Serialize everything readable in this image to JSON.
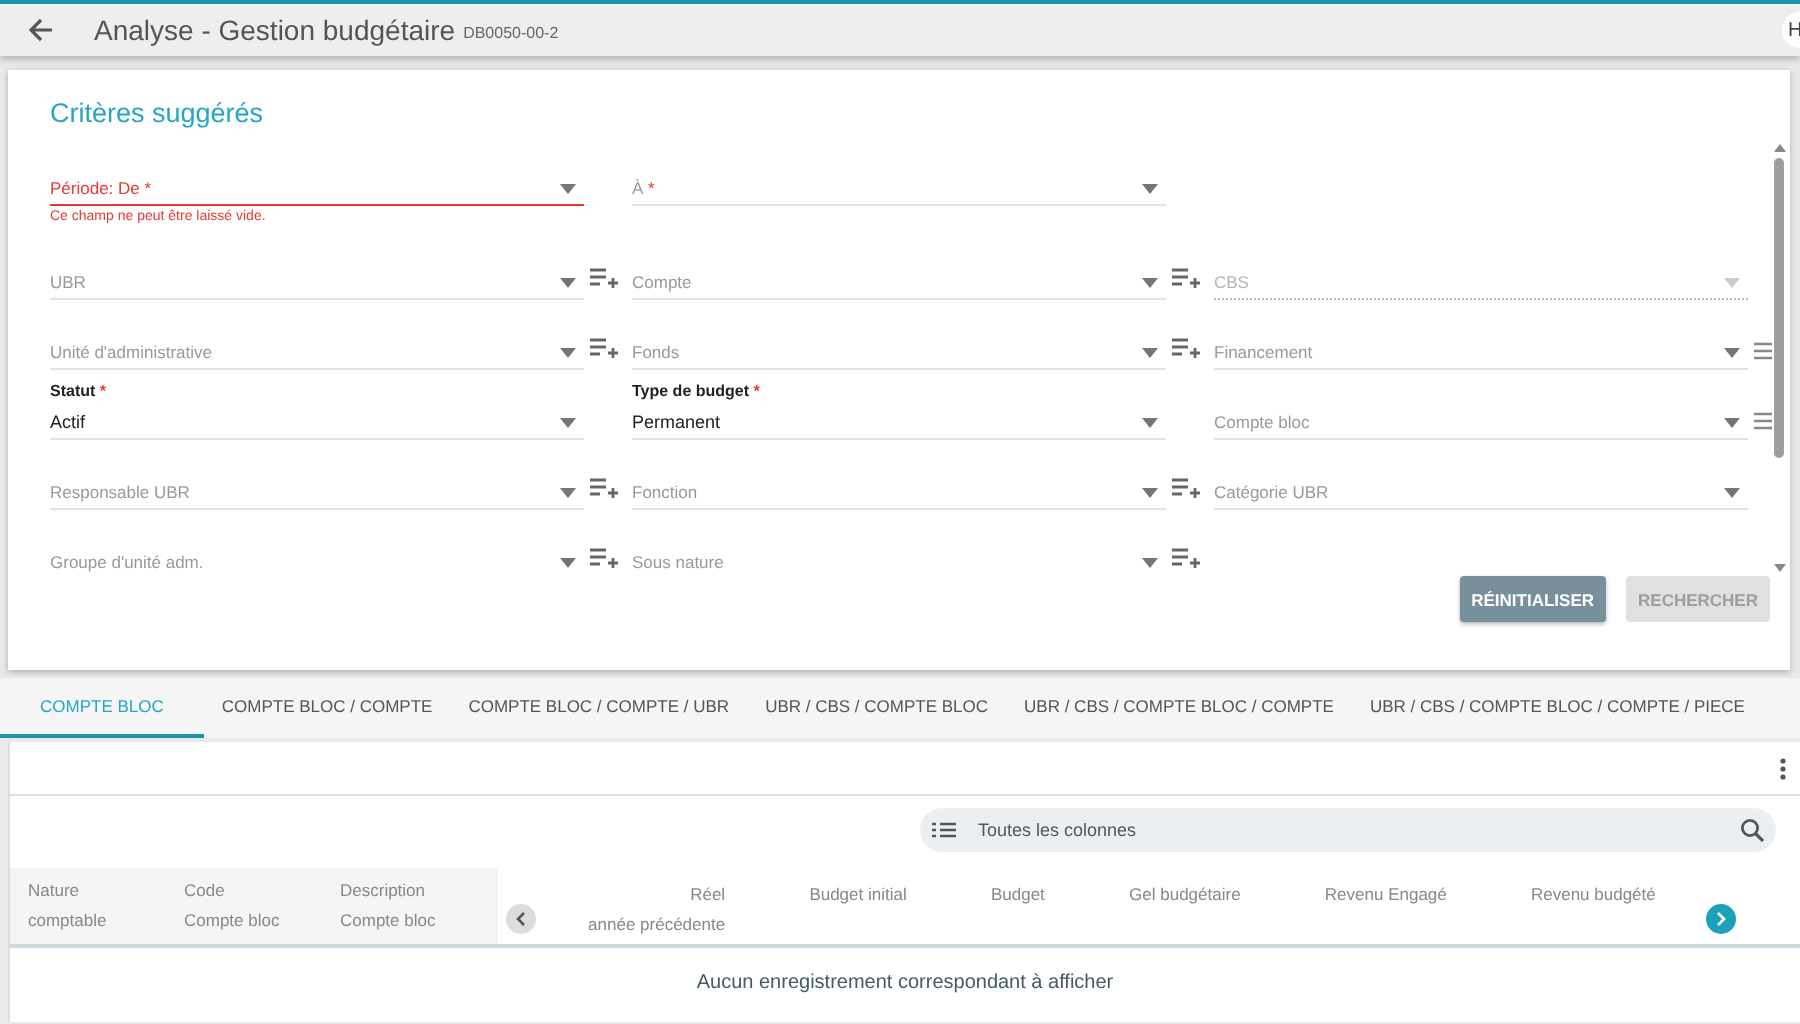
{
  "header": {
    "title": "Analyse - Gestion budgétaire",
    "code": "DB0050-00-2",
    "user_badge": "H"
  },
  "criteria": {
    "title": "Critères suggérés",
    "rows": [
      {
        "fields": [
          {
            "label": "Période: De",
            "mark": "*",
            "error": "Ce champ ne peut être laissé vide.",
            "disabled": false,
            "add_icon": false,
            "list_icon": false
          },
          {
            "label": "À",
            "mark": "*",
            "disabled": false,
            "add_icon": false,
            "list_icon": false
          }
        ]
      },
      {
        "fields": [
          {
            "label": "UBR",
            "disabled": false,
            "add_icon": true,
            "list_icon": false
          },
          {
            "label": "Compte",
            "disabled": false,
            "add_icon": true,
            "list_icon": false
          },
          {
            "label": "CBS",
            "disabled": true,
            "add_icon": false,
            "list_icon": false
          }
        ]
      },
      {
        "fields": [
          {
            "label": "Unité d'administrative",
            "disabled": false,
            "add_icon": true,
            "list_icon": false
          },
          {
            "label": "Fonds",
            "disabled": false,
            "add_icon": true,
            "list_icon": false
          },
          {
            "label": "Financement",
            "disabled": false,
            "add_icon": false,
            "list_icon": true
          }
        ]
      },
      {
        "fields": [
          {
            "label": "Statut",
            "mark": "*",
            "value": "Actif",
            "disabled": false,
            "add_icon": false,
            "list_icon": false
          },
          {
            "label": "Type de budget",
            "mark": "*",
            "value": "Permanent",
            "disabled": false,
            "add_icon": false,
            "list_icon": false
          },
          {
            "label": "Compte bloc",
            "disabled": false,
            "add_icon": false,
            "list_icon": true
          }
        ]
      },
      {
        "fields": [
          {
            "label": "Responsable UBR",
            "disabled": false,
            "add_icon": true,
            "list_icon": false
          },
          {
            "label": "Fonction",
            "disabled": false,
            "add_icon": true,
            "list_icon": false
          },
          {
            "label": "Catégorie UBR",
            "disabled": false,
            "add_icon": false,
            "list_icon": false
          }
        ]
      },
      {
        "fields": [
          {
            "label": "Groupe d'unité adm.",
            "disabled": false,
            "add_icon": true,
            "list_icon": false
          },
          {
            "label": "Sous nature",
            "disabled": false,
            "add_icon": true,
            "list_icon": false
          }
        ]
      }
    ],
    "buttons": [
      {
        "label": "RÉINITIALISER",
        "disabled": false
      },
      {
        "label": "RECHERCHER",
        "disabled": true
      }
    ]
  },
  "tabs": [
    {
      "label": "COMPTE BLOC",
      "selected": true
    },
    {
      "label": "COMPTE BLOC / COMPTE",
      "selected": false
    },
    {
      "label": "COMPTE BLOC / COMPTE / UBR",
      "selected": false
    },
    {
      "label": "UBR / CBS / COMPTE BLOC",
      "selected": false
    },
    {
      "label": "UBR / CBS / COMPTE BLOC / COMPTE",
      "selected": false
    },
    {
      "label": "UBR / CBS / COMPTE BLOC / COMPTE / PIECE",
      "selected": false
    }
  ],
  "table": {
    "search": {
      "placeholder": "Toutes les colonnes"
    },
    "fixed_columns": [
      {
        "lines": [
          "Nature",
          "comptable"
        ]
      },
      {
        "lines": [
          "Code",
          "Compte bloc"
        ]
      },
      {
        "lines": [
          "Description",
          "Compte bloc"
        ]
      }
    ],
    "columns": [
      {
        "lines": [
          "Réel",
          "année précédente"
        ]
      },
      {
        "lines": [
          "Budget initial"
        ]
      },
      {
        "lines": [
          "Budget"
        ]
      },
      {
        "lines": [
          "Gel budgétaire"
        ]
      },
      {
        "lines": [
          "Revenu Engagé"
        ]
      },
      {
        "lines": [
          "Revenu budgété"
        ]
      }
    ],
    "empty_message": "Aucun enregistrement correspondant à afficher"
  }
}
